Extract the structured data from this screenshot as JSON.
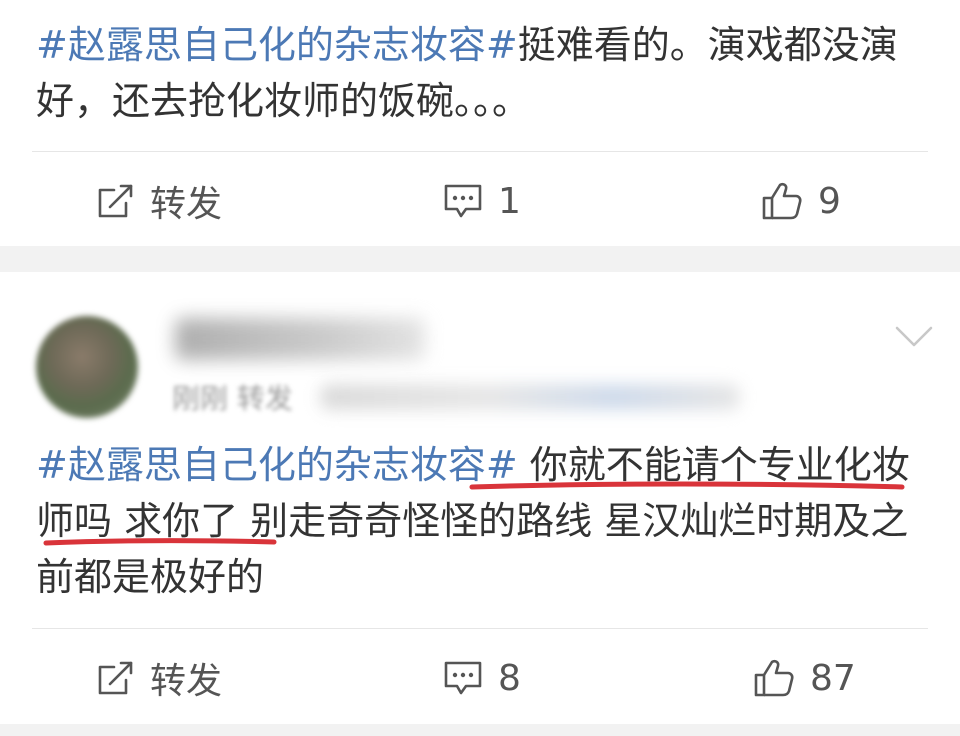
{
  "post1": {
    "topic": "#赵露思自己化的杂志妆容#",
    "body": "挺难看的。演戏都没演好，还去抢化妆师的饭碗。。。",
    "actions": {
      "repost_label": "转发",
      "comment_count": "1",
      "like_count": "9"
    }
  },
  "post2": {
    "meta_time": "刚刚 转发",
    "topic": "#赵露思自己化的杂志妆容#",
    "body_underlined_1": " 你就不能请个专业化",
    "body_underlined_2": "妆师吗 求你了",
    "body_rest": " 别走奇奇怪怪的路线 星汉灿烂时期及之前都是极好的",
    "actions": {
      "repost_label": "转发",
      "comment_count": "8",
      "like_count": "87"
    }
  },
  "colors": {
    "topic": "#4c79b5",
    "annotation": "#d9343a",
    "text": "#333333",
    "icon": "#555555"
  },
  "icons": [
    "repost-icon",
    "comment-icon",
    "like-icon",
    "chevron-down-icon"
  ]
}
